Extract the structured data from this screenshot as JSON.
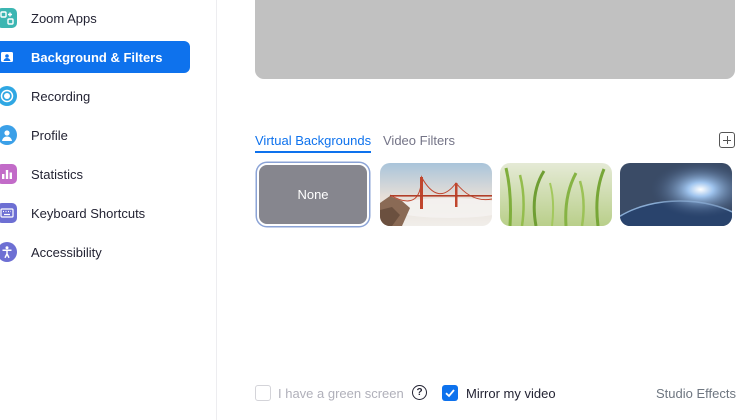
{
  "sidebar": {
    "items": [
      {
        "label": "Zoom Apps",
        "icon": "zoom-apps-icon",
        "color": "#3cb6b2",
        "active": false
      },
      {
        "label": "Background & Filters",
        "icon": "background-filters-icon",
        "color": "#0e72ed",
        "active": true
      },
      {
        "label": "Recording",
        "icon": "recording-icon",
        "color": "#2fa7e3",
        "active": false
      },
      {
        "label": "Profile",
        "icon": "profile-icon",
        "color": "#3ba0e8",
        "active": false
      },
      {
        "label": "Statistics",
        "icon": "statistics-icon",
        "color": "#c26bc8",
        "active": false
      },
      {
        "label": "Keyboard Shortcuts",
        "icon": "keyboard-icon",
        "color": "#6d6fd3",
        "active": false
      },
      {
        "label": "Accessibility",
        "icon": "accessibility-icon",
        "color": "#6d6fd3",
        "active": false
      }
    ]
  },
  "main": {
    "tabs": [
      {
        "label": "Virtual Backgrounds",
        "active": true
      },
      {
        "label": "Video Filters",
        "active": false
      }
    ],
    "add_icon": "add-plus-icon",
    "thumbnails": [
      {
        "label": "None",
        "selected": true
      },
      {
        "label": "",
        "image": "golden-gate-bridge"
      },
      {
        "label": "",
        "image": "grass"
      },
      {
        "label": "",
        "image": "earth-from-space"
      }
    ]
  },
  "bottom": {
    "green_screen_label": "I have a green screen",
    "green_screen_checked": false,
    "mirror_label": "Mirror my video",
    "mirror_checked": true,
    "help_icon_glyph": "?",
    "studio_effects_label": "Studio Effects"
  },
  "colors": {
    "accent": "#0e72ed",
    "preview": "#c1c1c1"
  }
}
